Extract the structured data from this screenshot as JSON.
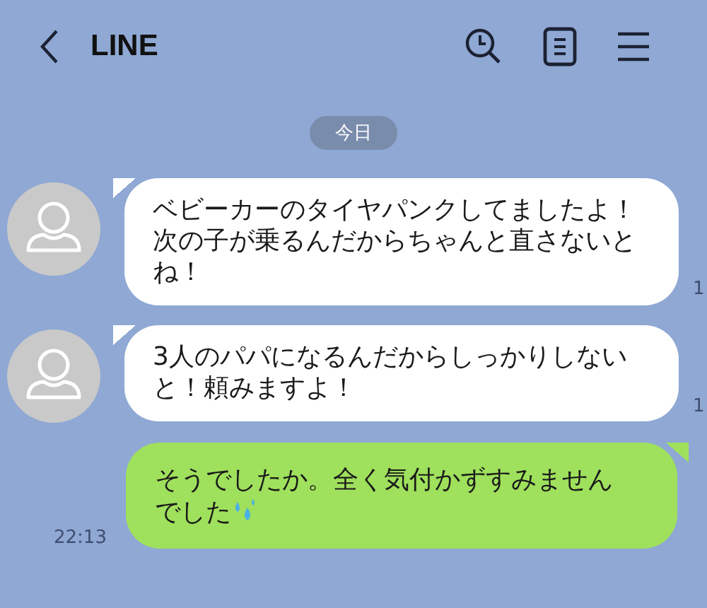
{
  "header": {
    "title": "LINE"
  },
  "date_label": "今日",
  "messages": [
    {
      "kind": "received",
      "text": "ベビーカーのタイヤパンクしてましたよ！次の子が乗るんだからちゃんと直さないとね！",
      "time": "1"
    },
    {
      "kind": "received",
      "text": "3人のパパになるんだからしっかりしないと！頼みますよ！",
      "time": "1"
    },
    {
      "kind": "sent",
      "text": "そうでしたか。全く気付かずすみませんでした",
      "time": "22:13",
      "emoji": true
    }
  ]
}
